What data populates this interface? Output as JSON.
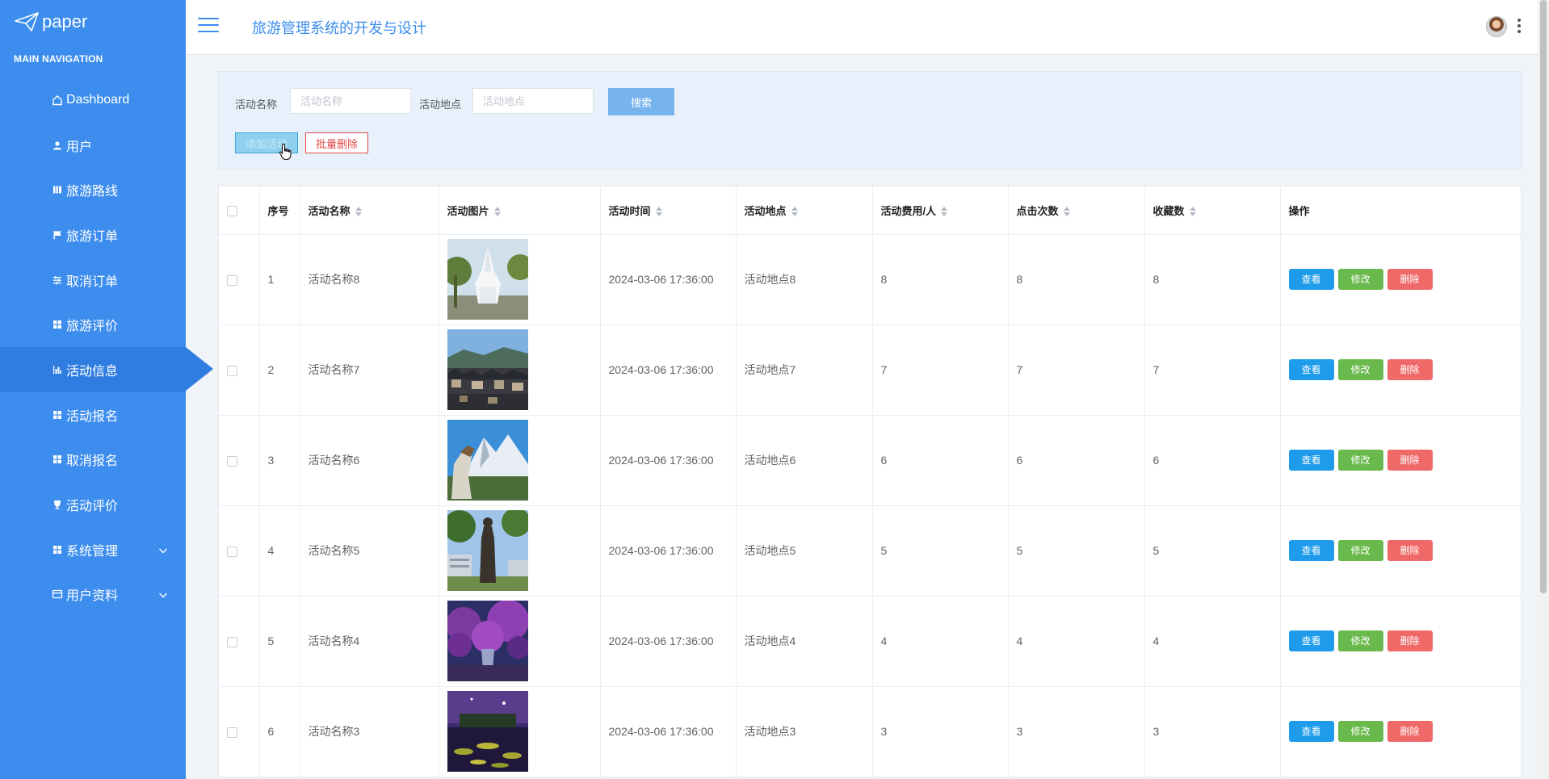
{
  "app": {
    "logo_text": "paper",
    "nav_header": "MAIN NAVIGATION",
    "site_title": "旅游管理系统的开发与设计"
  },
  "sidebar": {
    "items": [
      {
        "label": "Dashboard",
        "icon": "home-icon"
      },
      {
        "label": "用户",
        "icon": "user-icon"
      },
      {
        "label": "旅游路线",
        "icon": "book-icon"
      },
      {
        "label": "旅游订单",
        "icon": "flag-icon"
      },
      {
        "label": "取消订单",
        "icon": "sliders-icon"
      },
      {
        "label": "旅游评价",
        "icon": "grid-icon"
      },
      {
        "label": "活动信息",
        "icon": "bar-chart-icon",
        "active": true
      },
      {
        "label": "活动报名",
        "icon": "grid-icon"
      },
      {
        "label": "取消报名",
        "icon": "grid-icon"
      },
      {
        "label": "活动评价",
        "icon": "cup-icon"
      },
      {
        "label": "系统管理",
        "icon": "grid-icon",
        "expandable": true
      },
      {
        "label": "用户资料",
        "icon": "card-icon",
        "expandable": true
      }
    ]
  },
  "search": {
    "name_label": "活动名称",
    "name_placeholder": "活动名称",
    "place_label": "活动地点",
    "place_placeholder": "活动地点",
    "search_button": "搜索",
    "add_button": "添加活动",
    "batch_delete_button": "批量删除"
  },
  "table": {
    "columns": [
      "序号",
      "活动名称",
      "活动图片",
      "活动时间",
      "活动地点",
      "活动费用/人",
      "点击次数",
      "收藏数",
      "操作"
    ],
    "actions": {
      "view": "查看",
      "edit": "修改",
      "delete": "删除"
    },
    "rows": [
      {
        "index": "1",
        "name": "活动名称8",
        "time": "2024-03-06 17:36:00",
        "place": "活动地点8",
        "fee": "8",
        "clicks": "8",
        "favorites": "8",
        "image": "white-temple"
      },
      {
        "index": "2",
        "name": "活动名称7",
        "time": "2024-03-06 17:36:00",
        "place": "活动地点7",
        "fee": "7",
        "clicks": "7",
        "favorites": "7",
        "image": "old-town"
      },
      {
        "index": "3",
        "name": "活动名称6",
        "time": "2024-03-06 17:36:00",
        "place": "活动地点6",
        "fee": "6",
        "clicks": "6",
        "favorites": "6",
        "image": "snow-mountain"
      },
      {
        "index": "4",
        "name": "活动名称5",
        "time": "2024-03-06 17:36:00",
        "place": "活动地点5",
        "fee": "5",
        "clicks": "5",
        "favorites": "5",
        "image": "statue"
      },
      {
        "index": "5",
        "name": "活动名称4",
        "time": "2024-03-06 17:36:00",
        "place": "活动地点4",
        "fee": "4",
        "clicks": "4",
        "favorites": "4",
        "image": "purple-trees"
      },
      {
        "index": "6",
        "name": "活动名称3",
        "time": "2024-03-06 17:36:00",
        "place": "活动地点3",
        "fee": "3",
        "clicks": "3",
        "favorites": "3",
        "image": "night-lotus"
      }
    ]
  },
  "colors": {
    "sidebar_bg": "#3c8dee",
    "sidebar_active": "#2f7de0",
    "primary": "#3c8dee",
    "view_btn": "#1e9bea",
    "edit_btn": "#6ab94c",
    "delete_btn": "#ef6969"
  }
}
